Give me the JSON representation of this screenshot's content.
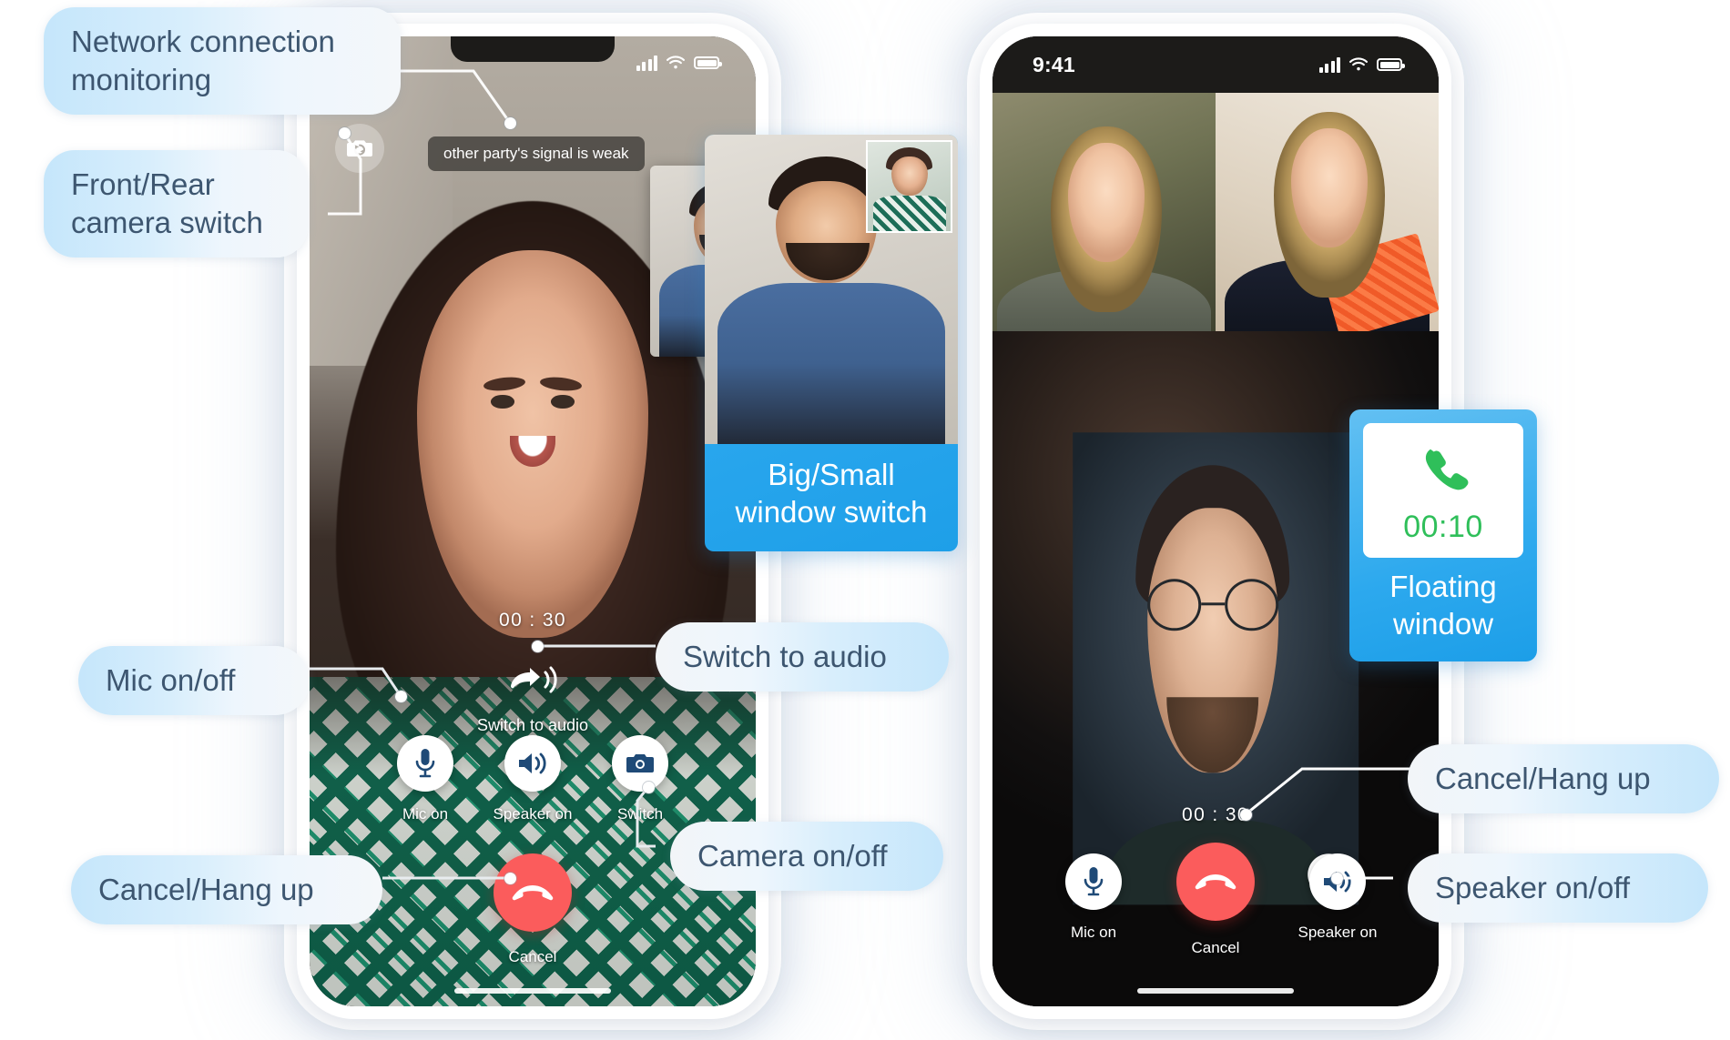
{
  "callouts": {
    "network_monitoring": "Network connection\nmonitoring",
    "camera_switch": "Front/Rear\ncamera switch",
    "mic_toggle": "Mic on/off",
    "switch_to_audio": "Switch to audio",
    "camera_toggle": "Camera on/off",
    "cancel_hangup_left": "Cancel/Hang up",
    "cancel_hangup_right": "Cancel/Hang up",
    "speaker_toggle": "Speaker on/off",
    "big_small_window": "Big/Small\nwindow switch",
    "floating_window": "Floating\nwindow"
  },
  "left_phone": {
    "status_bar": {
      "time": "",
      "signal_icon": "cellular-signal-icon",
      "wifi_icon": "wifi-icon",
      "battery_icon": "battery-icon"
    },
    "camera_switch_icon": "camera-flip-icon",
    "network_toast": "other party's signal is weak",
    "timer": "00 : 30",
    "switch_audio": {
      "icon": "switch-to-audio-icon",
      "label": "Switch to audio"
    },
    "controls": [
      {
        "icon": "microphone-icon",
        "label": "Mic on"
      },
      {
        "icon": "speaker-icon",
        "label": "Speaker on"
      },
      {
        "icon": "camera-icon",
        "label": "Switch"
      }
    ],
    "hangup": {
      "icon": "hangup-phone-icon",
      "label": "Cancel"
    }
  },
  "right_phone": {
    "status_bar": {
      "time": "9:41",
      "signal_icon": "cellular-signal-icon",
      "wifi_icon": "wifi-icon",
      "battery_icon": "battery-icon"
    },
    "speaking_badge_icon": "speaking-indicator-icon",
    "timer": "00 : 30",
    "controls": [
      {
        "icon": "microphone-icon",
        "label": "Mic on"
      },
      {
        "icon": "speaker-icon",
        "label": "Speaker on"
      }
    ],
    "hangup": {
      "icon": "hangup-phone-icon",
      "label": "Cancel"
    }
  },
  "floating_window_card": {
    "phone_icon": "green-phone-icon",
    "duration": "00:10",
    "label": "Floating\nwindow"
  },
  "colors": {
    "callout_text": "#3d5670",
    "callout_bg_start": "#c5e6fb",
    "card_blue": "#2aa7ee",
    "hangup_red": "#fb5c5c",
    "accent_green": "#2fbf5a",
    "control_icon_blue": "#1f4a77"
  }
}
